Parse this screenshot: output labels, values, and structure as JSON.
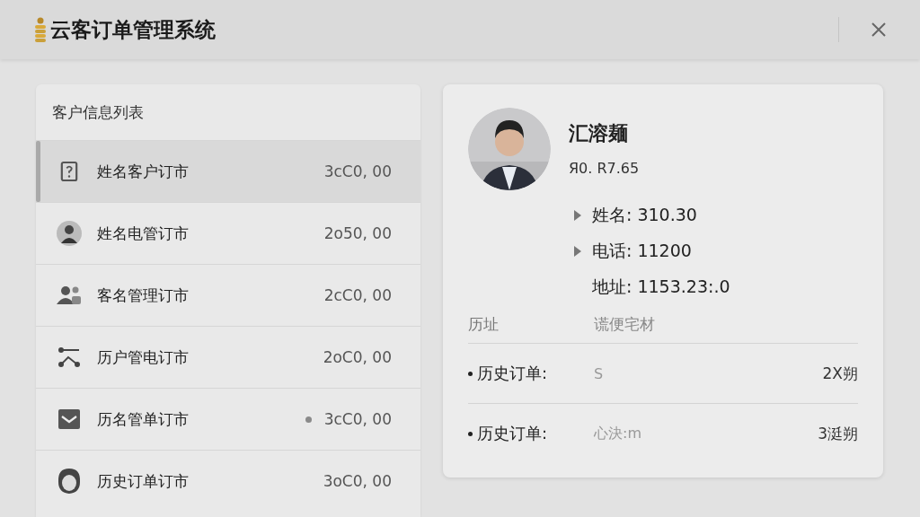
{
  "window": {
    "title": "云客订单管理系统"
  },
  "customer_list": {
    "title": "客户信息列表",
    "rows": [
      {
        "name": "姓名客户订市",
        "amount": "3cC0, 00",
        "selected": true,
        "unread": false
      },
      {
        "name": "姓名电管订市",
        "amount": "2o50, 00",
        "selected": false,
        "unread": false
      },
      {
        "name": "客名管理订市",
        "amount": "2cC0, 00",
        "selected": false,
        "unread": false
      },
      {
        "name": "历户管电订市",
        "amount": "2oC0, 00",
        "selected": false,
        "unread": false
      },
      {
        "name": "历名管单订市",
        "amount": "3cC0, 00",
        "selected": false,
        "unread": true
      },
      {
        "name": "历史订单订市",
        "amount": "3oC0, 00",
        "selected": false,
        "unread": false
      }
    ]
  },
  "detail": {
    "name": "汇溶麺",
    "subtitle": "Я0. R7.65",
    "fields": [
      {
        "label": "姓名:",
        "value": "310.30",
        "marker": true
      },
      {
        "label": "电话:",
        "value": "11200",
        "marker": true
      },
      {
        "label": "地址:",
        "value": "1153.23:.0",
        "marker": false
      }
    ],
    "info": {
      "label": "历址",
      "value": "谎便宅材"
    },
    "orders": [
      {
        "label": "历史订单:",
        "note": "S",
        "date": "2X朔"
      },
      {
        "label": "历史订单:",
        "note": "心決:m",
        "date": "3涏朔"
      }
    ]
  }
}
